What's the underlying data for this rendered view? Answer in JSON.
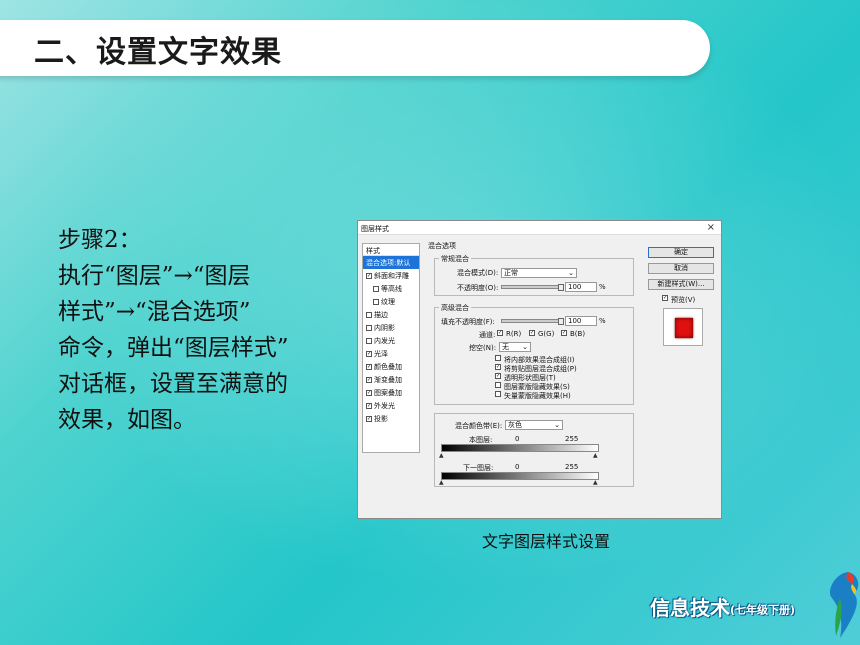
{
  "slide": {
    "title": "二、设置文字效果",
    "body_lines": [
      "步骤2：",
      "执行“图层”→“图层",
      "样式”→“混合选项”",
      "命令，弹出“图层样式”",
      "对话框，设置至满意的",
      "效果，如图。"
    ],
    "caption": "文字图层样式设置",
    "logo_main": "信息技术",
    "logo_sub": "(七年级下册)"
  },
  "dialog": {
    "title": "图层样式",
    "close": "×",
    "styles_header": "样式",
    "styles": [
      {
        "label": "混合选项:默认",
        "checked": null,
        "selected": true,
        "sub": false
      },
      {
        "label": "斜面和浮雕",
        "checked": true,
        "selected": false,
        "sub": false
      },
      {
        "label": "等高线",
        "checked": false,
        "selected": false,
        "sub": true
      },
      {
        "label": "纹理",
        "checked": false,
        "selected": false,
        "sub": true
      },
      {
        "label": "描边",
        "checked": false,
        "selected": false,
        "sub": false
      },
      {
        "label": "内阴影",
        "checked": false,
        "selected": false,
        "sub": false
      },
      {
        "label": "内发光",
        "checked": false,
        "selected": false,
        "sub": false
      },
      {
        "label": "光泽",
        "checked": true,
        "selected": false,
        "sub": false
      },
      {
        "label": "颜色叠加",
        "checked": true,
        "selected": false,
        "sub": false
      },
      {
        "label": "渐变叠加",
        "checked": true,
        "selected": false,
        "sub": false
      },
      {
        "label": "图案叠加",
        "checked": true,
        "selected": false,
        "sub": false
      },
      {
        "label": "外发光",
        "checked": true,
        "selected": false,
        "sub": false
      },
      {
        "label": "投影",
        "checked": true,
        "selected": false,
        "sub": false
      }
    ],
    "blend_options": "混合选项",
    "general": {
      "label": "常规混合",
      "mode_label": "混合模式(D):",
      "mode_value": "正常",
      "opacity_label": "不透明度(O):",
      "opacity_value": "100",
      "unit": "%"
    },
    "advanced": {
      "label": "高级混合",
      "fill_label": "填充不透明度(F):",
      "fill_value": "100",
      "unit": "%",
      "channels_label": "通道:",
      "channels": [
        "R(R)",
        "G(G)",
        "B(B)"
      ],
      "knockout_label": "挖空(N):",
      "knockout_value": "无",
      "options": [
        {
          "label": "将内部效果混合成组(I)",
          "checked": false
        },
        {
          "label": "将剪贴图层混合成组(P)",
          "checked": true
        },
        {
          "label": "透明形状图层(T)",
          "checked": true
        },
        {
          "label": "图层蒙版隐藏效果(S)",
          "checked": false
        },
        {
          "label": "矢量蒙版隐藏效果(H)",
          "checked": false
        }
      ]
    },
    "blend_if": {
      "label": "混合颜色带(E):",
      "value": "灰色",
      "this_layer": "本图层:",
      "under_layer": "下一图层:",
      "low": "0",
      "high": "255"
    },
    "buttons": {
      "ok": "确定",
      "cancel": "取消",
      "new_style": "新建样式(W)...",
      "preview": "预览(V)"
    },
    "check_mark": "✓",
    "preview_color": "#e01010"
  }
}
